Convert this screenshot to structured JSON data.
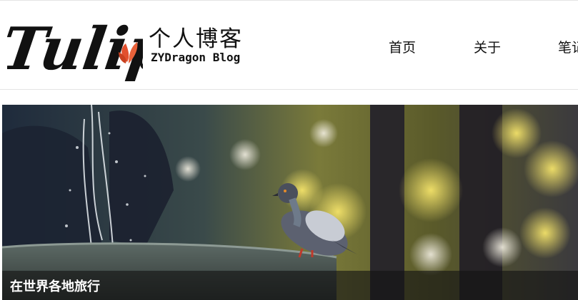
{
  "header": {
    "logo_text": "Tulip",
    "site_title": "个人博客",
    "site_subtitle": "ZYDragon Blog"
  },
  "nav": {
    "items": [
      {
        "label": "首页"
      },
      {
        "label": "关于"
      },
      {
        "label": "笔记"
      }
    ]
  },
  "hero": {
    "caption": "在世界各地旅行"
  },
  "colors": {
    "logo_text": "#111111",
    "logo_petals": "#e2502e",
    "caption_overlay": "#141414"
  }
}
